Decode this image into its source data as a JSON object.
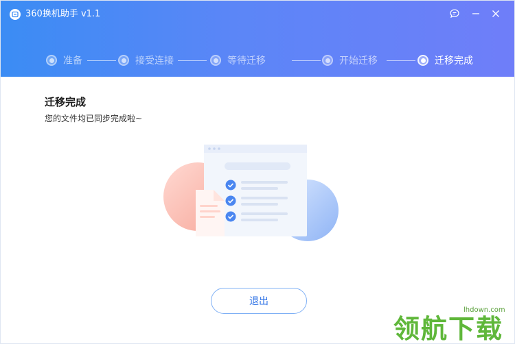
{
  "app": {
    "title": "360换机助手 v1.1",
    "logo_icon": "phone-swap-icon"
  },
  "window_controls": {
    "feedback_icon": "chat-bubble-icon",
    "minimize_icon": "minimize-icon",
    "close_icon": "close-icon"
  },
  "steps": [
    {
      "label": "准备",
      "state": "done"
    },
    {
      "label": "接受连接",
      "state": "done"
    },
    {
      "label": "等待迁移",
      "state": "done"
    },
    {
      "label": "开始迁移",
      "state": "done"
    },
    {
      "label": "迁移完成",
      "state": "active"
    }
  ],
  "main": {
    "title": "迁移完成",
    "subtitle": "您的文件均已同步完成啦~",
    "illustration_icon": "sync-complete-illustration",
    "exit_label": "退出"
  },
  "watermark": {
    "url": "lhdown.com",
    "text": "领航下载"
  },
  "colors": {
    "header_gradient_start": "#3b8cf4",
    "header_gradient_end": "#6f7ef9",
    "accent": "#2f73e6",
    "check_blue": "#4a86f0",
    "watermark_green": "#5fb73a"
  }
}
